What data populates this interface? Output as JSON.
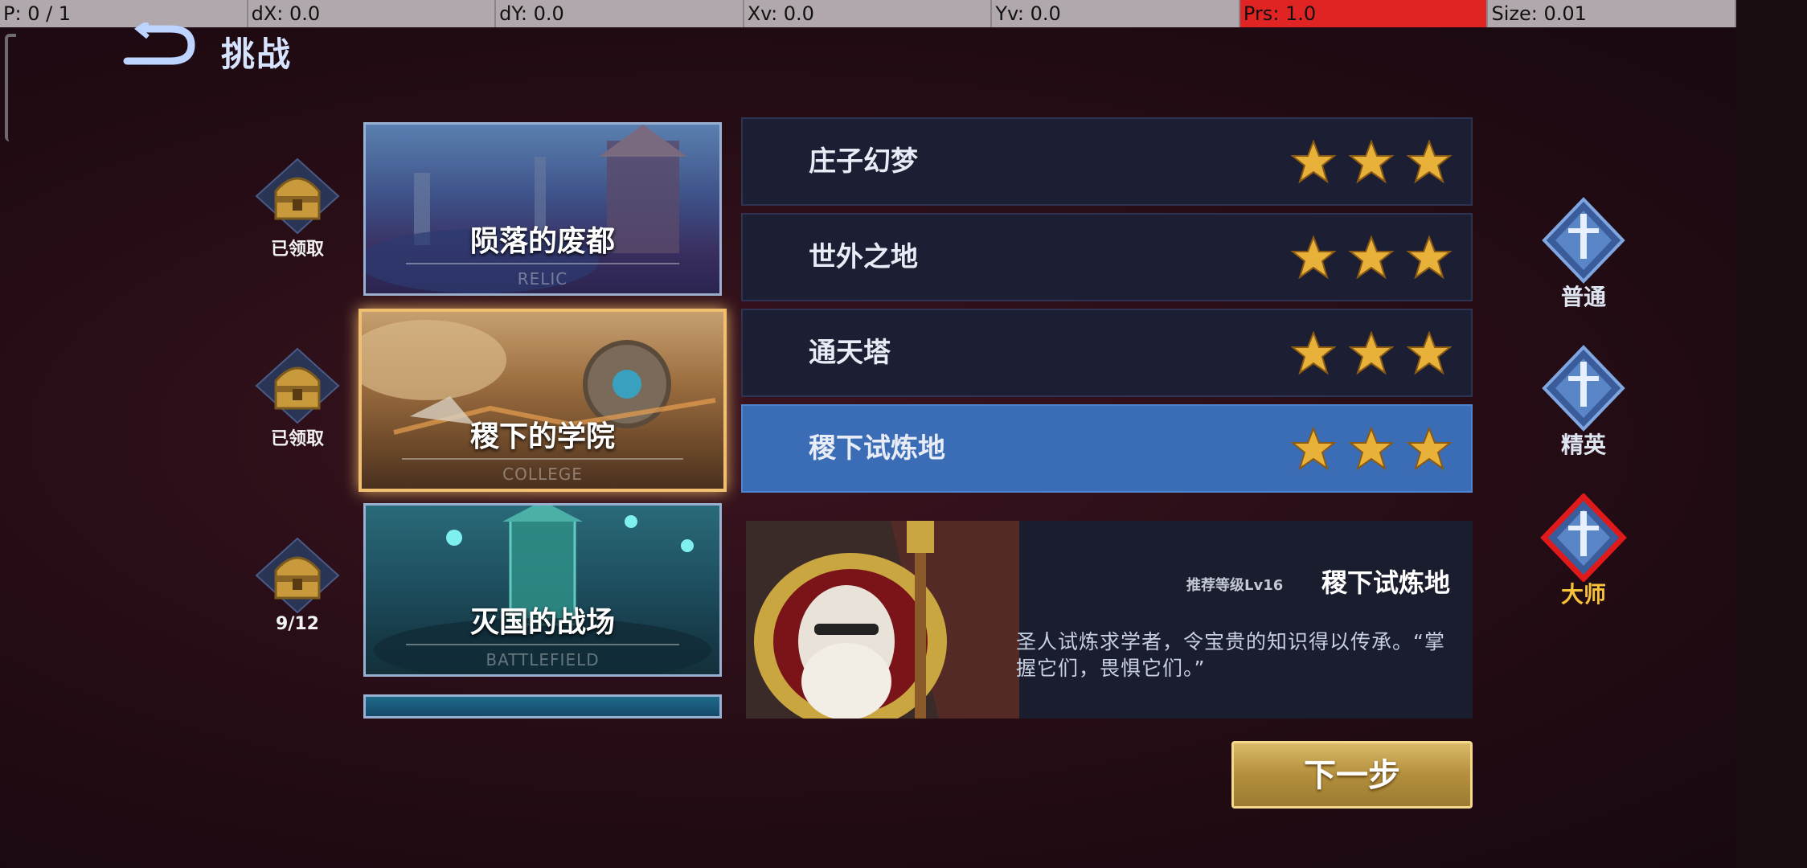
{
  "debug": {
    "pointer": "P: 0 / 1",
    "dx": "dX: 0.0",
    "dy": "dY: 0.0",
    "xv": "Xv: 0.0",
    "yv": "Yv: 0.0",
    "prs": "Prs: 1.0",
    "size": "Size: 0.01"
  },
  "header": {
    "title": "挑战"
  },
  "chests": [
    {
      "label": "已领取"
    },
    {
      "label": "已领取"
    },
    {
      "label": "9/12"
    }
  ],
  "maps": [
    {
      "name": "陨落的废都",
      "en": "RELIC",
      "selected": false
    },
    {
      "name": "稷下的学院",
      "en": "COLLEGE",
      "selected": true
    },
    {
      "name": "灭国的战场",
      "en": "BATTLEFIELD",
      "selected": false
    }
  ],
  "stages": [
    {
      "name": "庄子幻梦",
      "stars": 3,
      "active": false
    },
    {
      "name": "世外之地",
      "stars": 3,
      "active": false
    },
    {
      "name": "通天塔",
      "stars": 3,
      "active": false
    },
    {
      "name": "稷下试炼地",
      "stars": 3,
      "active": true
    }
  ],
  "detail": {
    "recommend": "推荐等级Lv16",
    "name": "稷下试炼地",
    "description": "圣人试炼求学者，令宝贵的知识得以传承。“掌握它们，畏惧它们。”"
  },
  "next_button": "下一步",
  "difficulty": [
    {
      "label": "普通",
      "selected": false
    },
    {
      "label": "精英",
      "selected": false
    },
    {
      "label": "大师",
      "selected": true
    }
  ],
  "colors": {
    "accent_blue": "#3b6db6",
    "gold": "#f6c23a",
    "selected_red": "#e01a1a"
  },
  "icons": {
    "back": "back-arrow-icon",
    "chest": "treasure-chest-icon",
    "star": "star-icon",
    "difficulty": "sword-shield-emblem-icon"
  }
}
